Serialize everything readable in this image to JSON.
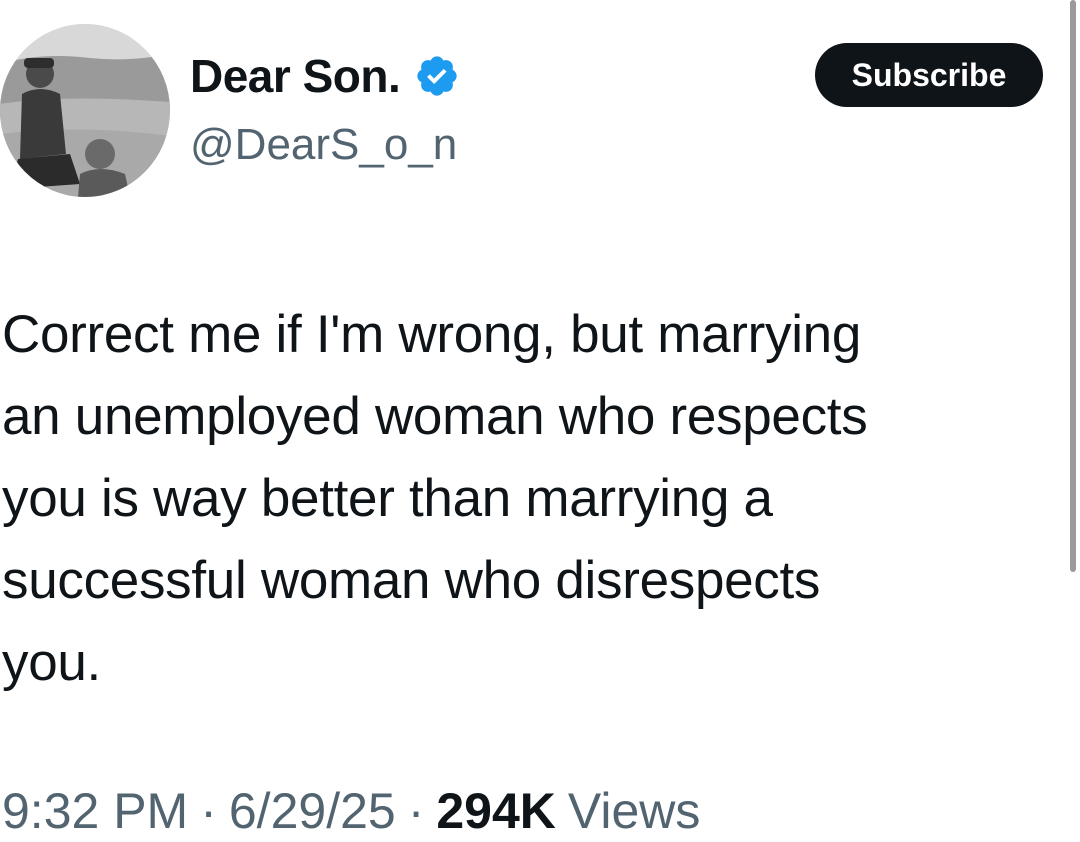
{
  "author": {
    "display_name": "Dear Son.",
    "handle": "@DearS_o_n",
    "verified": true,
    "avatar_icon": "profile-photo"
  },
  "subscribe_button": {
    "label": "Subscribe"
  },
  "tweet": {
    "text_lines": [
      "Correct me if I'm wrong, but marrying",
      "an unemployed woman who respects",
      "you is way better than marrying a",
      "successful woman who disrespects",
      "you."
    ],
    "time": "9:32 PM",
    "date": "6/29/25",
    "separator": "·",
    "views_count": "294K",
    "views_label": "Views"
  },
  "colors": {
    "text_primary": "#0f1419",
    "text_secondary": "#536471",
    "verified_blue": "#1d9bf0",
    "button_bg": "#0f1419",
    "button_text": "#ffffff"
  }
}
